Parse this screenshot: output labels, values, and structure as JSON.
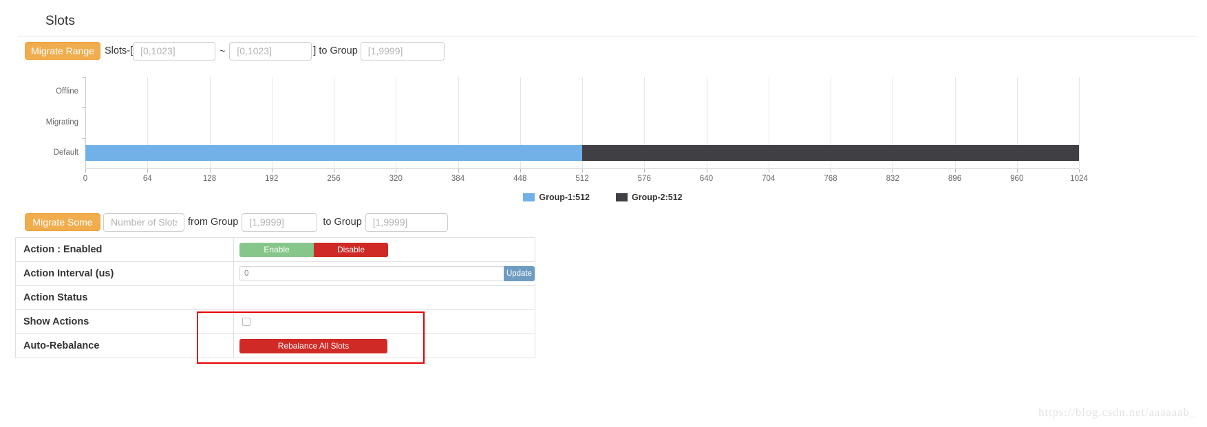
{
  "panel": {
    "title": "Slots"
  },
  "migrate_range": {
    "button_label": "Migrate Range",
    "label_slots": "Slots-[",
    "tilde": "~",
    "label_to_group": "] to Group",
    "from_placeholder": "[0,1023]",
    "to_placeholder": "[0,1023]",
    "group_placeholder": "[1,9999]",
    "from_value": "",
    "to_value": "",
    "group_value": ""
  },
  "migrate_some": {
    "button_label": "Migrate Some",
    "count_placeholder": "Number of Slots",
    "count_value": "",
    "label_from_group": "from Group",
    "from_group_placeholder": "[1,9999]",
    "from_group_value": "",
    "label_to_group": "to Group",
    "to_group_placeholder": "[1,9999]",
    "to_group_value": ""
  },
  "chart_data": {
    "type": "bar",
    "orientation": "horizontal",
    "title": "",
    "xlabel": "",
    "ylabel": "",
    "categories": [
      "Default",
      "Migrating",
      "Offline"
    ],
    "xlim": [
      0,
      1024
    ],
    "xticks": [
      0,
      64,
      128,
      192,
      256,
      320,
      384,
      448,
      512,
      576,
      640,
      704,
      768,
      832,
      896,
      960,
      1024
    ],
    "grid": true,
    "legend_position": "bottom",
    "stacked": true,
    "series": [
      {
        "name": "Group-1:512",
        "legend_label": "Group-1:512",
        "color": "#72b1e8",
        "category": "Default",
        "start": 0,
        "end": 512,
        "value": 512
      },
      {
        "name": "Group-2:512",
        "legend_label": "Group-2:512",
        "color": "#3f3f44",
        "category": "Default",
        "start": 512,
        "end": 1024,
        "value": 512
      }
    ]
  },
  "settings": {
    "rows": [
      {
        "key": "Action : Enabled",
        "type": "segmented"
      },
      {
        "key": "Action Interval (us)",
        "type": "input-update"
      },
      {
        "key": "Action Status",
        "type": "empty"
      },
      {
        "key": "Show Actions",
        "type": "checkbox"
      },
      {
        "key": "Auto-Rebalance",
        "type": "button"
      }
    ],
    "enable_label": "Enable",
    "disable_label": "Disable",
    "interval_value": "0",
    "interval_placeholder": "",
    "update_label": "Update",
    "action_status_value": "",
    "show_actions_checked": false,
    "rebalance_label": "Rebalance All Slots"
  },
  "colors": {
    "orange": "#f0ad4e",
    "group1": "#72b1e8",
    "group2": "#3f3f44",
    "enable_green": "#87c68a",
    "disable_red": "#cf2a25",
    "update_blue": "#6f9cc2",
    "annotation_red": "#e60000"
  },
  "watermark": {
    "text": "https://blog.csdn.net/aaaaaab_"
  }
}
